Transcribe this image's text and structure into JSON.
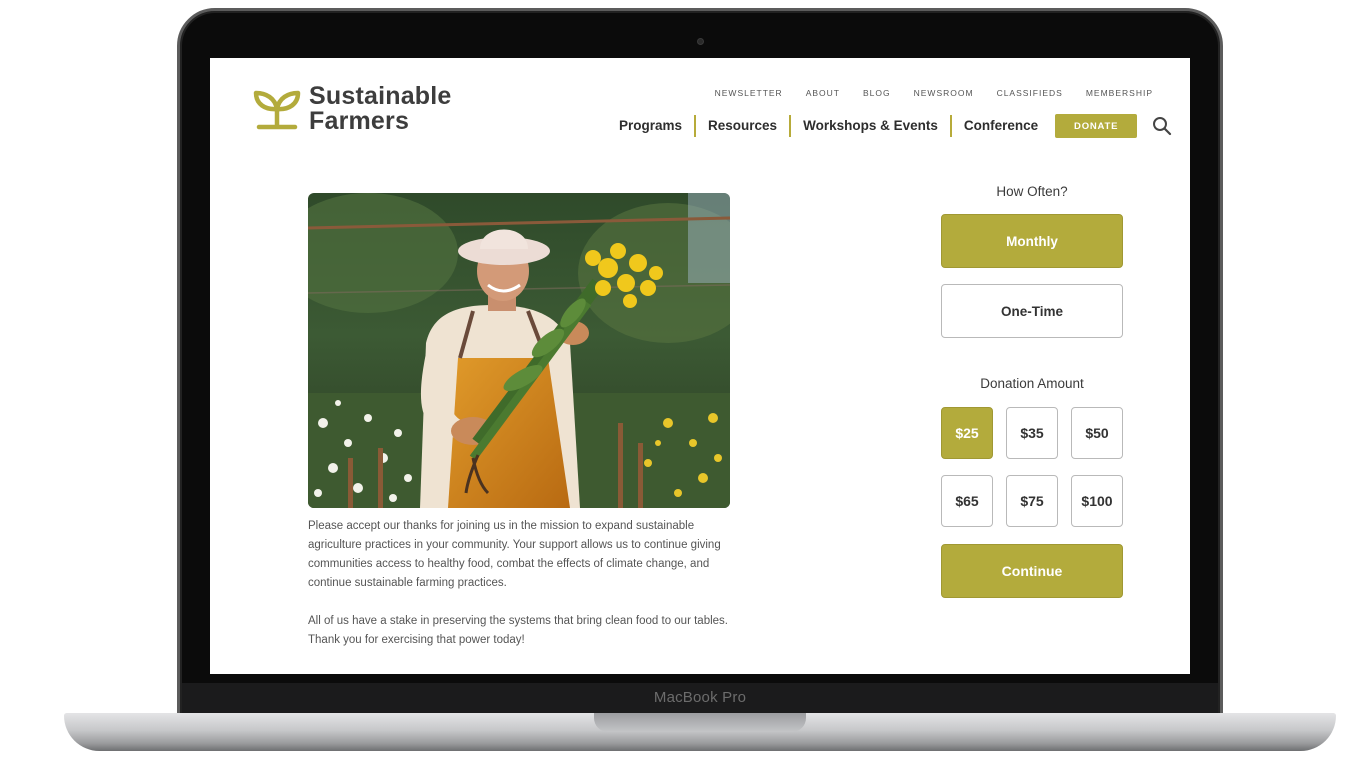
{
  "device": {
    "model_label": "MacBook Pro"
  },
  "brand": {
    "name_line1": "Sustainable",
    "name_line2": "Farmers",
    "accent_color": "#b3ab3c"
  },
  "utility_nav": [
    "NEWSLETTER",
    "ABOUT",
    "BLOG",
    "NEWSROOM",
    "CLASSIFIEDS",
    "MEMBERSHIP"
  ],
  "main_nav": {
    "items": [
      "Programs",
      "Resources",
      "Workshops & Events",
      "Conference"
    ],
    "donate_label": "DONATE",
    "search_icon": "search-icon"
  },
  "hero": {
    "image_subject": "farmer in sun hat and orange apron holding yellow flowers in a flower field"
  },
  "copy": {
    "paragraph1": "Please accept our thanks for joining us in the mission to expand sustainable agriculture practices in your community. Your support allows us to continue giving communities access to healthy food, combat the effects of climate change, and continue sustainable farming practices.",
    "paragraph2": "All of us have a stake in preserving the systems that bring clean food to our tables. Thank you for exercising that power today!"
  },
  "donation": {
    "frequency_label": "How Often?",
    "frequency_options": [
      {
        "label": "Monthly",
        "selected": true
      },
      {
        "label": "One-Time",
        "selected": false
      }
    ],
    "amount_label": "Donation Amount",
    "amounts": [
      {
        "label": "$25",
        "selected": true
      },
      {
        "label": "$35",
        "selected": false
      },
      {
        "label": "$50",
        "selected": false
      },
      {
        "label": "$65",
        "selected": false
      },
      {
        "label": "$75",
        "selected": false
      },
      {
        "label": "$100",
        "selected": false
      }
    ],
    "continue_label": "Continue"
  }
}
